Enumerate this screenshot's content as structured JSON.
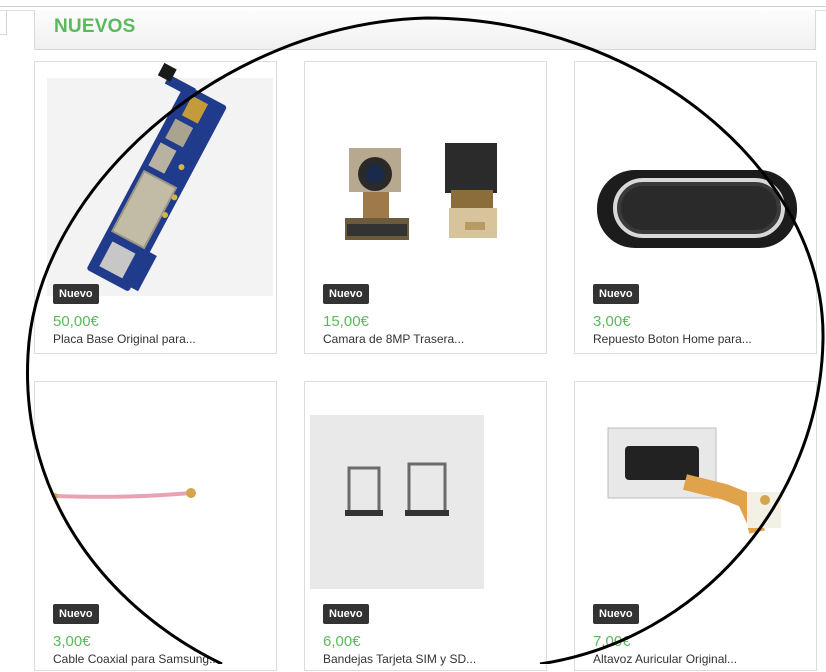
{
  "section": {
    "title": "NUEVOS"
  },
  "products": [
    {
      "badge": "Nuevo",
      "price": "50,00€",
      "name": "Placa Base Original para...",
      "image": "motherboard"
    },
    {
      "badge": "Nuevo",
      "price": "15,00€",
      "name": "Camara de 8MP Trasera...",
      "image": "camera-module"
    },
    {
      "badge": "Nuevo",
      "price": "3,00€",
      "name": "Repuesto Boton Home para...",
      "image": "home-button"
    },
    {
      "badge": "Nuevo",
      "price": "3,00€",
      "name": "Cable Coaxial para Samsung...",
      "image": "coaxial-cable"
    },
    {
      "badge": "Nuevo",
      "price": "6,00€",
      "name": "Bandejas Tarjeta SIM y SD...",
      "image": "sim-trays"
    },
    {
      "badge": "Nuevo",
      "price": "7,00€",
      "name": "Altavoz Auricular Original...",
      "image": "earpiece-speaker"
    }
  ],
  "overlay": {
    "annotation": "hand-drawn-ellipse",
    "color": "#000000"
  }
}
